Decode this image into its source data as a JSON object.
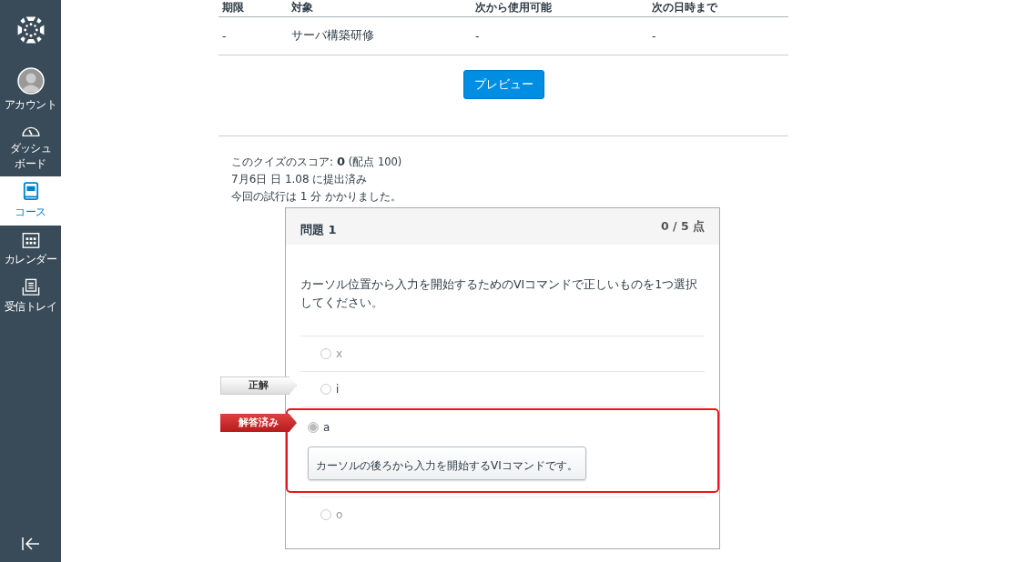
{
  "sidebar": {
    "items": [
      {
        "label": "アカウント",
        "kind": "avatar",
        "selected": false
      },
      {
        "label": "ダッシュボード",
        "kind": "gauge",
        "selected": false
      },
      {
        "label": "コース",
        "kind": "book",
        "selected": true
      },
      {
        "label": "カレンダー",
        "kind": "calendar",
        "selected": false
      },
      {
        "label": "受信トレイ",
        "kind": "inbox",
        "selected": false
      }
    ]
  },
  "table": {
    "columns": [
      "期限",
      "対象",
      "次から使用可能",
      "次の日時まで"
    ],
    "rows": [
      [
        "-",
        "サーバ構築研修",
        "-",
        "-"
      ]
    ]
  },
  "preview_button": "プレビュー",
  "summary": {
    "score_label": "このクイズのスコア:",
    "score": "0",
    "points": "(配点 100)",
    "submitted": "7月6日 日 1.08 に提出済み",
    "duration": "今回の試行は 1 分 かかりました。"
  },
  "question": {
    "title": "問題 1",
    "points": "0 / 5 点",
    "text": "カーソル位置から入力を開始するためのVIコマンドで正しいものを1つ選択してください。",
    "answers": [
      {
        "text": "x",
        "selected": false
      },
      {
        "text": "i",
        "selected": false,
        "flag": {
          "kind": "correct",
          "label": "正解"
        }
      },
      {
        "text": "a",
        "selected": true,
        "flag": {
          "kind": "answered",
          "label": "解答済み"
        },
        "comment": "カーソルの後ろから入力を開始するVIコマンドです。"
      },
      {
        "text": "o",
        "selected": false
      }
    ]
  }
}
